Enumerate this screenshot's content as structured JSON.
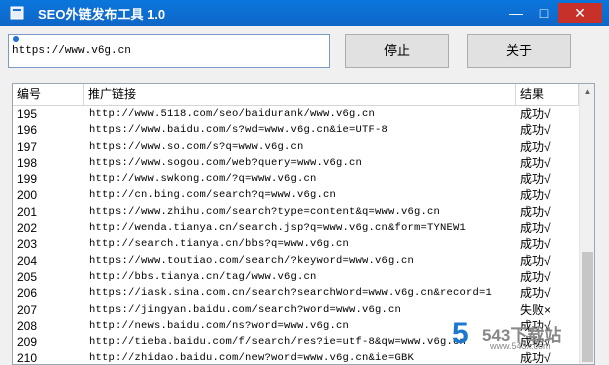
{
  "window": {
    "title": "SEO外链发布工具 1.0",
    "min": "—",
    "max": "□",
    "close": "✕"
  },
  "url_input": {
    "value": "https://www.v6g.cn"
  },
  "buttons": {
    "stop": "停止",
    "about": "关于"
  },
  "table": {
    "headers": {
      "num": "编号",
      "link": "推广链接",
      "result": "结果"
    },
    "rows": [
      {
        "num": "195",
        "link": "http://www.5118.com/seo/baidurank/www.v6g.cn",
        "result": "成功√"
      },
      {
        "num": "196",
        "link": "https://www.baidu.com/s?wd=www.v6g.cn&ie=UTF-8",
        "result": "成功√"
      },
      {
        "num": "197",
        "link": "https://www.so.com/s?q=www.v6g.cn",
        "result": "成功√"
      },
      {
        "num": "198",
        "link": "https://www.sogou.com/web?query=www.v6g.cn",
        "result": "成功√"
      },
      {
        "num": "199",
        "link": "http://www.swkong.com/?q=www.v6g.cn",
        "result": "成功√"
      },
      {
        "num": "200",
        "link": "http://cn.bing.com/search?q=www.v6g.cn",
        "result": "成功√"
      },
      {
        "num": "201",
        "link": "https://www.zhihu.com/search?type=content&q=www.v6g.cn",
        "result": "成功√"
      },
      {
        "num": "202",
        "link": "http://wenda.tianya.cn/search.jsp?q=www.v6g.cn&form=TYNEW1",
        "result": "成功√"
      },
      {
        "num": "203",
        "link": "http://search.tianya.cn/bbs?q=www.v6g.cn",
        "result": "成功√"
      },
      {
        "num": "204",
        "link": "https://www.toutiao.com/search/?keyword=www.v6g.cn",
        "result": "成功√"
      },
      {
        "num": "205",
        "link": "http://bbs.tianya.cn/tag/www.v6g.cn",
        "result": "成功√"
      },
      {
        "num": "206",
        "link": "https://iask.sina.com.cn/search?searchWord=www.v6g.cn&record=1",
        "result": "成功√"
      },
      {
        "num": "207",
        "link": "https://jingyan.baidu.com/search?word=www.v6g.cn",
        "result": "失败×"
      },
      {
        "num": "208",
        "link": "http://news.baidu.com/ns?word=www.v6g.cn",
        "result": "成功√"
      },
      {
        "num": "209",
        "link": "http://tieba.baidu.com/f/search/res?ie=utf-8&qw=www.v6g.cn",
        "result": "成功√"
      },
      {
        "num": "210",
        "link": "http://zhidao.baidu.com/new?word=www.v6g.cn&ie=GBK",
        "result": "成功√"
      }
    ]
  },
  "watermark": {
    "text": "543下载站",
    "url": "www.543x.com"
  }
}
